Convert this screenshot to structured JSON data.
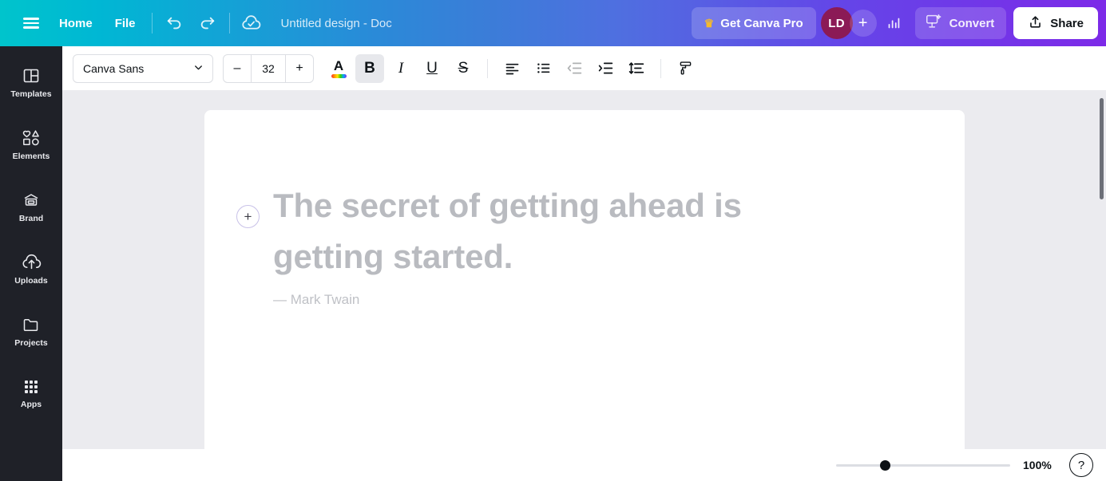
{
  "header": {
    "menu_icon": "hamburger-menu-icon",
    "home_label": "Home",
    "file_label": "File",
    "undo_icon": "undo-arrow-icon",
    "redo_icon": "redo-arrow-icon",
    "saved_icon": "cloud-check-saved-icon",
    "doc_title": "Untitled design - Doc",
    "pro_label": "Get Canva Pro",
    "crown_icon": "crown-icon",
    "avatar_initials": "LD",
    "add_collaborator_icon": "plus-icon",
    "analytics_icon": "bar-chart-analytics-icon",
    "convert_label": "Convert",
    "convert_icon": "magic-convert-icon",
    "share_label": "Share",
    "share_icon": "upload-share-icon",
    "gradient_start": "#00c4cc",
    "gradient_mid": "#3b7dd8",
    "gradient_end": "#7d2ae8",
    "avatar_color": "#8b1a56",
    "crown_color": "#f5ba2b"
  },
  "sidebar": {
    "background": "#1f2128",
    "items": [
      {
        "label": "Templates",
        "icon": "templates-icon"
      },
      {
        "label": "Elements",
        "icon": "elements-shapes-icon"
      },
      {
        "label": "Brand",
        "icon": "brand-icon"
      },
      {
        "label": "Uploads",
        "icon": "upload-cloud-icon"
      },
      {
        "label": "Projects",
        "icon": "folder-icon"
      },
      {
        "label": "Apps",
        "icon": "apps-grid-icon"
      }
    ]
  },
  "toolbar": {
    "font_family": "Canva Sans",
    "font_dropdown_icon": "chevron-down-icon",
    "decrease_size_label": "–",
    "font_size": "32",
    "increase_size_label": "+",
    "text_color_label": "A",
    "text_color_icon": "text-color-icon",
    "bold_label": "B",
    "bold_active": true,
    "italic_label": "I",
    "underline_label": "U",
    "strikethrough_label": "S",
    "align_icon": "align-left-icon",
    "list_icon": "bulleted-list-icon",
    "outdent_icon": "decrease-indent-icon",
    "outdent_disabled": true,
    "indent_icon": "increase-indent-icon",
    "spacing_icon": "line-spacing-icon",
    "format_painter_icon": "paint-roller-icon"
  },
  "canvas": {
    "background": "#ebebef",
    "page_background": "#ffffff",
    "add_block_label": "+",
    "quote_text": "The secret of getting ahead is getting started.",
    "attribution": "— Mark Twain",
    "placeholder_color": "#b9bbc0"
  },
  "bottom_bar": {
    "zoom_value": "100%",
    "zoom_percent": 28,
    "help_label": "?",
    "help_icon": "help-question-icon"
  }
}
